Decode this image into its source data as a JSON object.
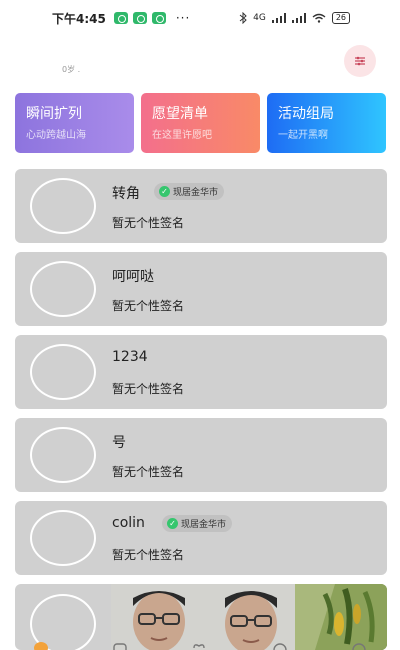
{
  "status_bar": {
    "time": "下午4:45",
    "dots": "···",
    "network": "4G",
    "battery": "26"
  },
  "header": {
    "age_text": "0岁 ."
  },
  "tiles": [
    {
      "title": "瞬间扩列",
      "subtitle": "心动跨越山海"
    },
    {
      "title": "愿望清单",
      "subtitle": "在这里许愿吧"
    },
    {
      "title": "活动组局",
      "subtitle": "一起开黑啊"
    }
  ],
  "users": [
    {
      "name": "转角",
      "location": "现居金华市",
      "signature": "暂无个性签名"
    },
    {
      "name": "呵呵哒",
      "location": "",
      "signature": "暂无个性签名"
    },
    {
      "name": "1234",
      "location": "",
      "signature": "暂无个性签名"
    },
    {
      "name": "号",
      "location": "",
      "signature": "暂无个性签名"
    },
    {
      "name": "colin",
      "location": "现居金华市",
      "signature": "暂无个性签名"
    }
  ],
  "colors": {
    "card_bg": "#d0d0d0",
    "tile_purple": "#8d74de",
    "tile_red": "#f36f8c",
    "tile_blue": "#1e6cf4",
    "verified_green": "#35c66e"
  }
}
